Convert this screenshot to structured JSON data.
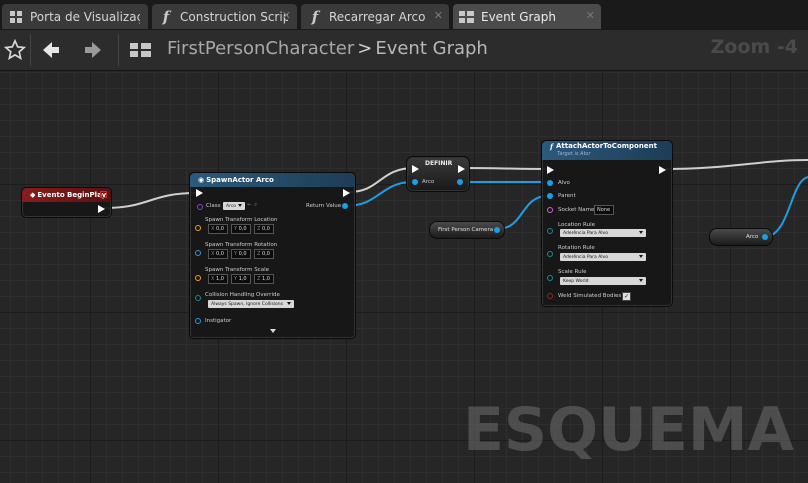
{
  "tabs": [
    {
      "label": "Porta de Visualizaç",
      "icon": "viewport-grid-icon"
    },
    {
      "label": "Construction Scrip",
      "icon": "function-icon"
    },
    {
      "label": "Recarregar Arco",
      "icon": "function-icon"
    },
    {
      "label": "Event Graph",
      "icon": "event-graph-grid-icon",
      "active": true
    }
  ],
  "tab_icon_glyph": "f",
  "breadcrumb": {
    "root": "FirstPersonCharacter",
    "separator": ">",
    "current": "Event Graph"
  },
  "zoom_label": "Zoom -4",
  "watermark": "ESQUEMA",
  "nodes": {
    "begin_play": {
      "title": "Evento BeginPlay"
    },
    "spawn_actor": {
      "title": "SpawnActor Arco",
      "class_label": "Class",
      "class_value": "Arco",
      "return_value": "Return Value",
      "location_label": "Spawn Transform Location",
      "location_values": [
        "X",
        "0,0",
        "Y",
        "0,0",
        "Z",
        "0,0"
      ],
      "rotation_label": "Spawn Transform Rotation",
      "rotation_values": [
        "X",
        "0,0",
        "Y",
        "0,0",
        "Z",
        "0,0"
      ],
      "scale_label": "Spawn Transform Scale",
      "scale_values": [
        "X",
        "1,0",
        "Y",
        "1,0",
        "Z",
        "1,0"
      ],
      "collision_label": "Collision Handling Override",
      "collision_value": "Always Spawn, Ignore Collisions",
      "instigator_label": "Instigator"
    },
    "set_node": {
      "title": "DEFINIR",
      "pin_label": "Arco"
    },
    "camera_node": {
      "label": "First Person Camera"
    },
    "attach": {
      "title": "AttachActorToComponent",
      "subtitle": "Target is Ator",
      "alvo": "Alvo",
      "parent": "Parent",
      "socket_label": "Socket Name",
      "socket_value": "None",
      "location_rule_label": "Location Rule",
      "location_rule_value": "Aderência Para Alvo",
      "rotation_rule_label": "Rotation Rule",
      "rotation_rule_value": "Aderência Para Alvo",
      "scale_rule_label": "Scale Rule",
      "scale_rule_value": "Keep World",
      "weld_label": "Weld Simulated Bodies",
      "weld_checked": true
    },
    "arco_getter": {
      "label": "Arco"
    }
  },
  "colors": {
    "exec": "#ffffff",
    "object_pin": "#1a9fe6",
    "struct_pin": "#f0a020",
    "event_header": "#8a1c1c",
    "function_header": "#2b5a7d"
  }
}
